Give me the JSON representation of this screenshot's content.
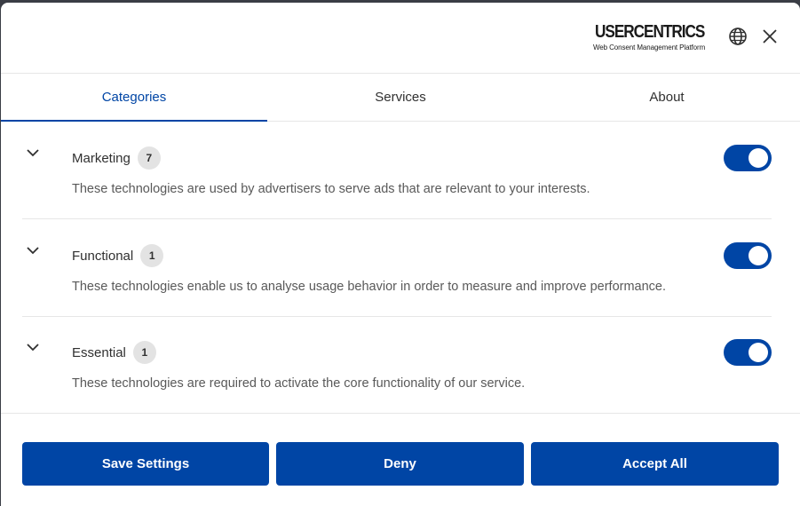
{
  "brand": {
    "name": "USERCENTRICS",
    "tagline": "Web Consent Management Platform",
    "icon": "shield-icon"
  },
  "header": {
    "language_icon": "globe-icon",
    "close_icon": "close-icon"
  },
  "tabs": [
    {
      "label": "Categories",
      "active": true
    },
    {
      "label": "Services",
      "active": false
    },
    {
      "label": "About",
      "active": false
    }
  ],
  "categories": [
    {
      "title": "Marketing",
      "count": "7",
      "description": "These technologies are used by advertisers to serve ads that are relevant to your interests.",
      "enabled": true
    },
    {
      "title": "Functional",
      "count": "1",
      "description": "These technologies enable us to analyse usage behavior in order to measure and improve performance.",
      "enabled": true
    },
    {
      "title": "Essential",
      "count": "1",
      "description": "These technologies are required to activate the core functionality of our service.",
      "enabled": true
    }
  ],
  "footer": {
    "save_label": "Save Settings",
    "deny_label": "Deny",
    "accept_label": "Accept All"
  },
  "colors": {
    "accent": "#0045a5",
    "badge_bg": "#e3e3e3",
    "divider": "#e6e6e6"
  }
}
